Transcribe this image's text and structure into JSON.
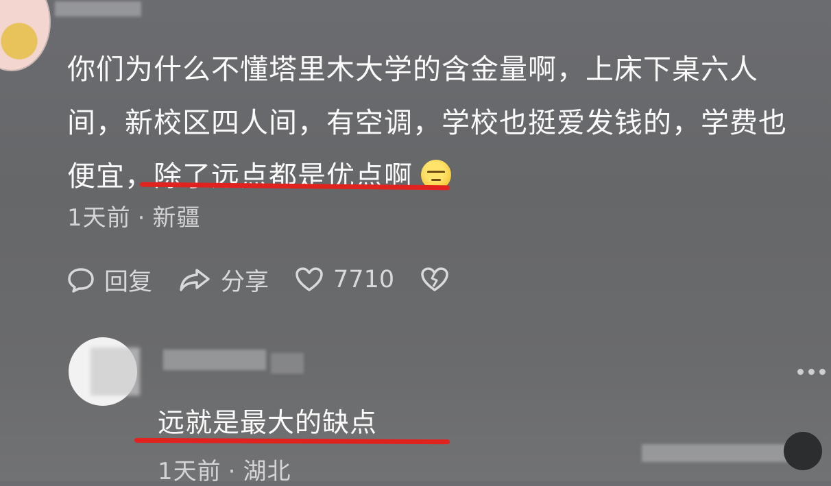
{
  "comment": {
    "text_before_highlight": "你们为什么不懂塔里木大学的含金量啊，上床下桌六人间，新校区四人间，有空调，学校也挺爱发钱的，学费也便宜，",
    "text_highlight": "除了远点都是优点啊",
    "emoji_icon": "sunglasses-smirk-emoji",
    "time": "1天前",
    "location": "新疆",
    "separator": "·",
    "actions": {
      "reply_label": "回复",
      "share_label": "分享",
      "like_count": "7710"
    }
  },
  "reply": {
    "text": "远就是最大的缺点",
    "time": "1天前",
    "location": "湖北",
    "separator": "·"
  },
  "colors": {
    "background": "#68696b",
    "underline": "#e0231e",
    "text": "#fafafa",
    "meta_text": "#d4d4d6"
  }
}
